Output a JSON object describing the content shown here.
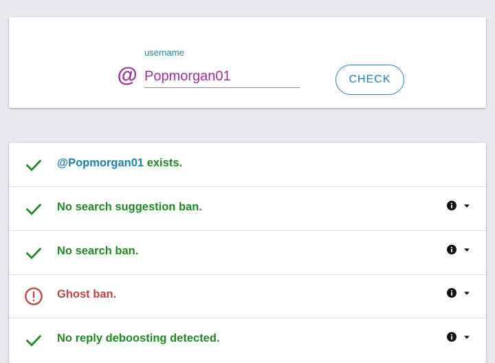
{
  "search": {
    "at_symbol": "@",
    "label": "username",
    "value": "Popmorgan01",
    "button_label": "CHECK"
  },
  "results": {
    "exists": {
      "handle": "@Popmorgan01",
      "text": " exists.",
      "status": "ok"
    },
    "search_suggestion_ban": {
      "text": "No search suggestion ban.",
      "status": "ok"
    },
    "search_ban": {
      "text": "No search ban.",
      "status": "ok"
    },
    "ghost_ban": {
      "text": "Ghost ban.",
      "status": "warning"
    },
    "reply_deboosting": {
      "text": "No reply deboosting detected.",
      "status": "ok"
    }
  },
  "colors": {
    "ok": "#1f8a1f",
    "warning": "#c0443d",
    "accent": "#1e7fb0",
    "handle": "#9c2f9f",
    "background": "#e6eaef"
  },
  "icons": {
    "ok": "check-icon",
    "warning": "alert-circle-icon",
    "info": "info-icon",
    "expand": "caret-down-icon"
  }
}
